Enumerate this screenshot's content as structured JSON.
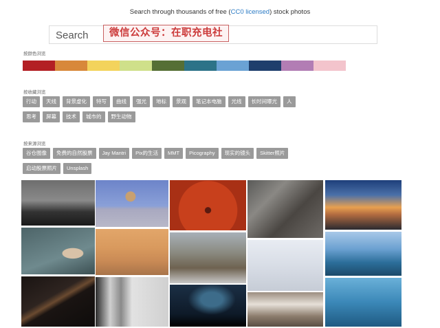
{
  "header": {
    "tagline_prefix": "Search through thousands of free (",
    "tagline_link": "CC0 licensed",
    "tagline_suffix": ") stock photos"
  },
  "search": {
    "label": "Search"
  },
  "watermark": {
    "text": "微信公众号：在职充电社"
  },
  "colors": {
    "label": "按颜色浏览",
    "swatches": [
      "#b31f24",
      "#d8883a",
      "#f3d35c",
      "#cfe08a",
      "#556f35",
      "#2c7388",
      "#6aa2d4",
      "#1e3e6c",
      "#b27db4",
      "#f3c4cc"
    ]
  },
  "collections": {
    "label": "按收藏浏览",
    "row1": [
      "行动",
      "天线",
      "背景虚化",
      "特写",
      "曲线",
      "强光",
      "地标",
      "景观",
      "笔记本电脑",
      "光线",
      "长时间曝光",
      "人"
    ],
    "row2": [
      "思考",
      "屏幕",
      "技术",
      "城市的",
      "野生动物"
    ]
  },
  "sources": {
    "label": "按来源浏览",
    "row1": [
      "谷仓图像",
      "免费的自然股票",
      "Jay Mantri",
      "Pix的生活",
      "MMT",
      "Picography",
      "现实的镜头",
      "Skitter照片"
    ],
    "row2": [
      "启动股票照片",
      "Unsplash"
    ]
  },
  "photos": [
    {
      "name": "photo-foggy-hill",
      "bg": "linear-gradient(#6e6e6e 0%, #8a8a8a 45%, #333 70%, #1a1a1a 100%)"
    },
    {
      "name": "photo-hand-coins",
      "bg": "radial-gradient(ellipse at 70% 55%, #d8c2a8 0 14%, transparent 15%), linear-gradient(160deg, #4d6468, #6f8a8e 60%, #3b4f52)"
    },
    {
      "name": "photo-dark-light-trail",
      "bg": "linear-gradient(150deg, #1a1412 0%, #2e2420 40%, #6a4a30 48%, #1a1412 55%, #0e0c0b 100%)"
    },
    {
      "name": "photo-cat-on-rock",
      "bg": "radial-gradient(circle at 48% 35%, #c8a070 0 10%, transparent 11%), linear-gradient(#6d84c9 0%, #8aa0d8 55%, #a8a8c0 62%, #b8b8c8 100%)"
    },
    {
      "name": "photo-birds-sunset",
      "bg": "linear-gradient(#e2a66a 0%, #d99a5e 40%, #c98a55 70%, #a8744a 100%)"
    },
    {
      "name": "photo-bw-sculpture",
      "bg": "linear-gradient(90deg, #2a2a2a 0%, #cfcfcf 20%, #8a8a8a 35%, #e2e2e2 50%, #d0d0d0 100%)"
    },
    {
      "name": "photo-red-umbrella",
      "bg": "radial-gradient(circle at 50% 60%, #5a1a10 0 6%, #c8401c 7% 60%, #a83015 61% 100%)"
    },
    {
      "name": "photo-ibex-snow",
      "bg": "linear-gradient(#a8b0b8 0%, #8a8a80 40%, #6e6250 70%, #c8c8c8 100%)"
    },
    {
      "name": "photo-starry-night",
      "bg": "radial-gradient(ellipse at 55% 35%, #3d6c8a 0 18%, transparent 40%), linear-gradient(#1b2f45 0%, #0e1a28 70%, #000 100%)"
    },
    {
      "name": "photo-bicycle-wall",
      "bg": "linear-gradient(135deg, #5a5a58 0%, #8a8884 30%, #4a4642 60%, #6e6a66 100%)"
    },
    {
      "name": "photo-snowy-landscape",
      "bg": "linear-gradient(#e8ecf2 0%, #d8dde6 50%, #c6ccd6 100%)"
    },
    {
      "name": "photo-cathedral-interior",
      "bg": "linear-gradient(#9c8e80 0%, #e6e0d8 35%, #8c7c6c 70%, #5a4e44 100%)"
    },
    {
      "name": "photo-mountain-sunrise",
      "bg": "linear-gradient(#1e3f7a 0%, #4a70a8 30%, #e8a050 55%, #b06a40 70%, #2a2a30 100%)"
    },
    {
      "name": "photo-infinity-pool",
      "bg": "linear-gradient(#a8c8e8 0%, #6aa0d0 40%, #2c6e9a 70%, #1c4a6a 100%)"
    },
    {
      "name": "photo-pier-blue",
      "bg": "linear-gradient(#6ab0d8 0%, #3b88b8 50%, #1f5a82 100%)"
    }
  ]
}
